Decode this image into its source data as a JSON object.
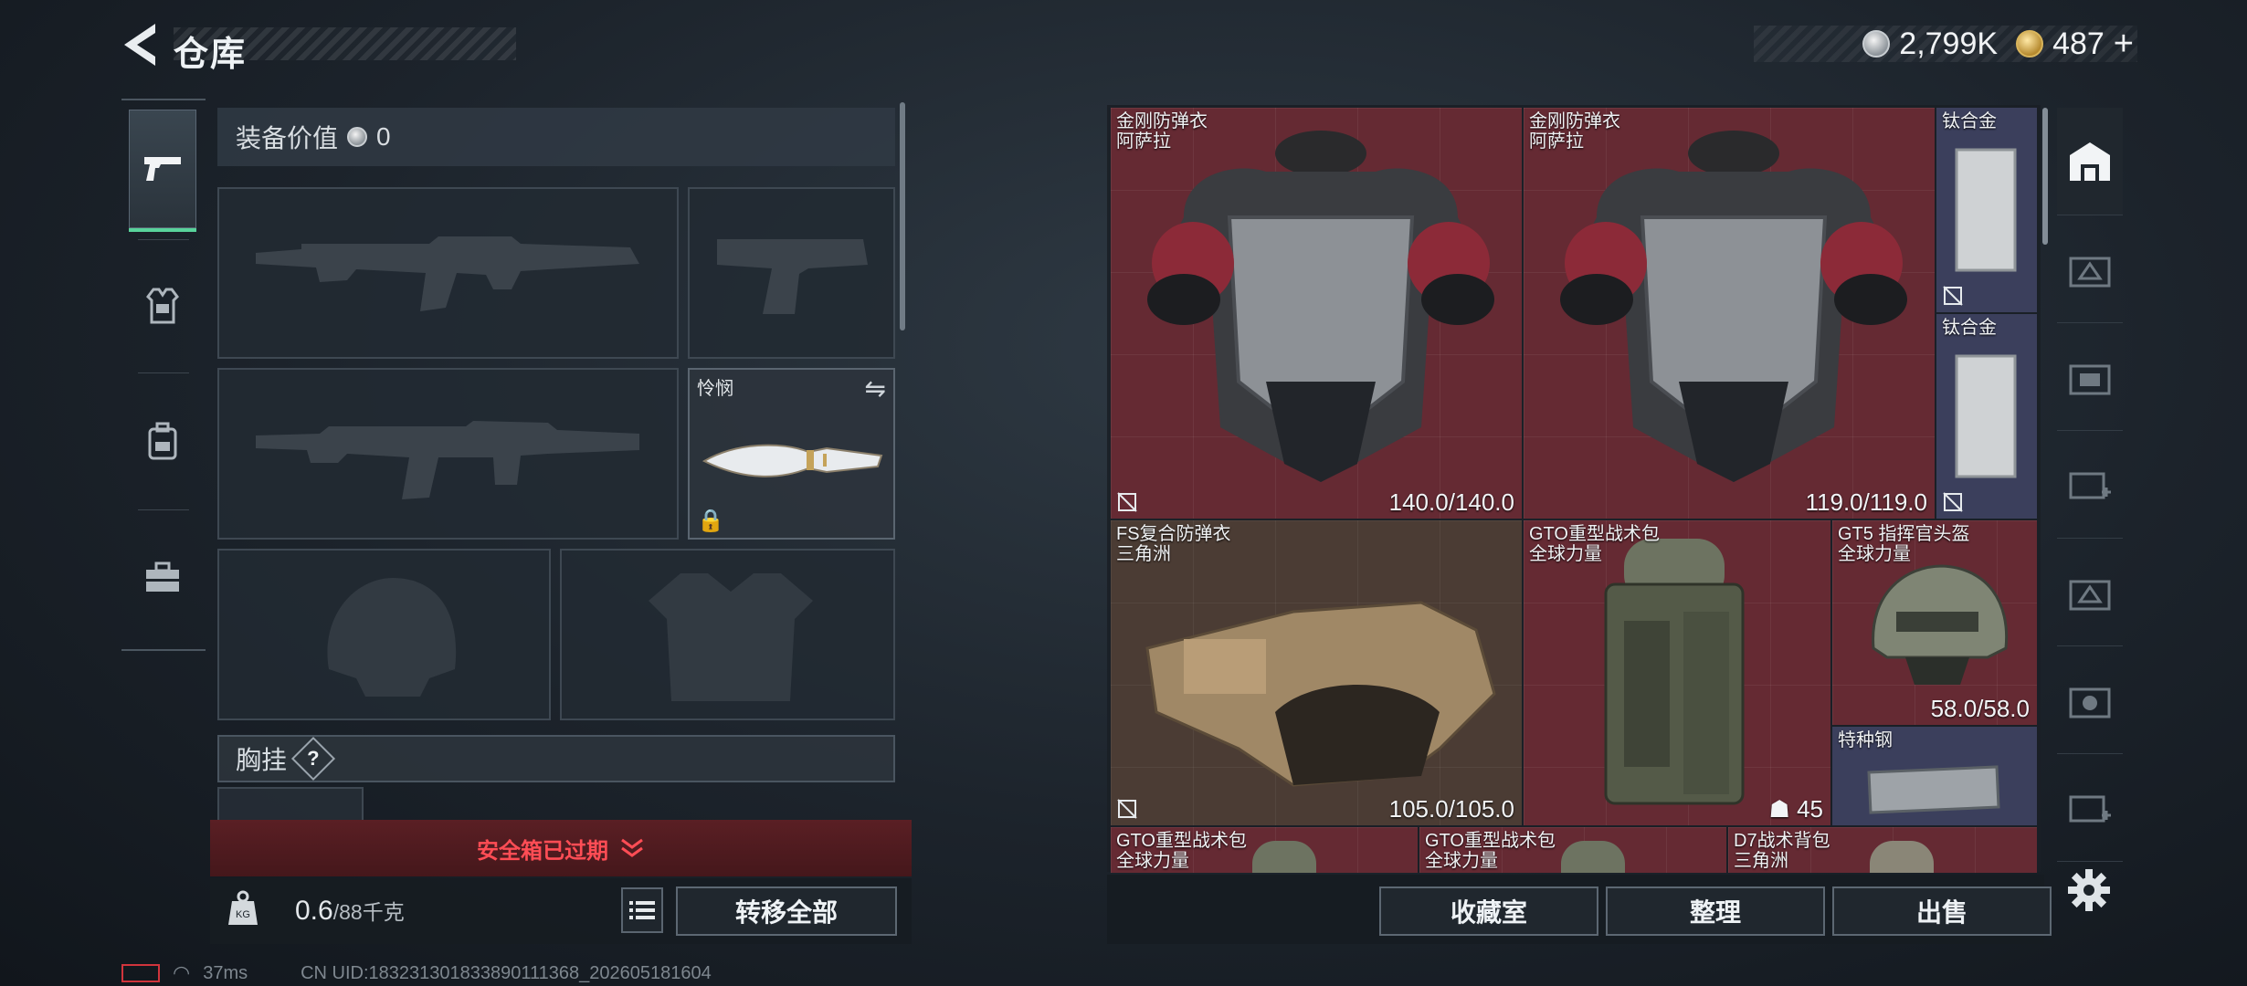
{
  "header": {
    "title": "仓库"
  },
  "currency": {
    "silver_amount": "2,799K",
    "gold_amount": "487",
    "gold_plus": "+"
  },
  "loadout": {
    "equipment_value_label": "装备价值",
    "equipment_value": "0",
    "melee_name": "怜悯",
    "chest_rig_label": "胸挂",
    "chest_rig_help": "?",
    "safe_box_status": "安全箱已过期",
    "weight_current": "0.6",
    "weight_max": "/88千克",
    "transfer_all_button": "转移全部"
  },
  "inventory": {
    "items": [
      {
        "name": "金刚防弹衣",
        "brand": "阿萨拉",
        "durability": "140.0/140.0"
      },
      {
        "name": "金刚防弹衣",
        "brand": "阿萨拉",
        "durability": "119.0/119.0"
      },
      {
        "name": "钛合金",
        "brand": "",
        "durability": ""
      },
      {
        "name": "钛合金",
        "brand": "",
        "durability": ""
      },
      {
        "name": "FS复合防弹衣",
        "brand": "三角洲",
        "durability": "105.0/105.0"
      },
      {
        "name": "GTO重型战术包",
        "brand": "全球力量",
        "count": "45"
      },
      {
        "name": "GT5 指挥官头盔",
        "brand": "全球力量",
        "durability": "58.0/58.0"
      },
      {
        "name": "特种钢",
        "brand": "",
        "durability": ""
      },
      {
        "name": "GTO重型战术包",
        "brand": "全球力量"
      },
      {
        "name": "GTO重型战术包",
        "brand": "全球力量"
      },
      {
        "name": "D7战术背包",
        "brand": "三角洲"
      }
    ],
    "buttons": {
      "collection": "收藏室",
      "sort": "整理",
      "sell": "出售"
    }
  },
  "status_bar": {
    "ping": "37ms",
    "uid": "CN UID:18323130183389011136​8_202605181604"
  },
  "colors": {
    "rarity_red": "#652a33",
    "rarity_brown": "#4b3c34",
    "rarity_purple": "#3b3f5c",
    "safe_box_alert": "#ff4d55",
    "active_tab_accent": "#58d39b"
  }
}
